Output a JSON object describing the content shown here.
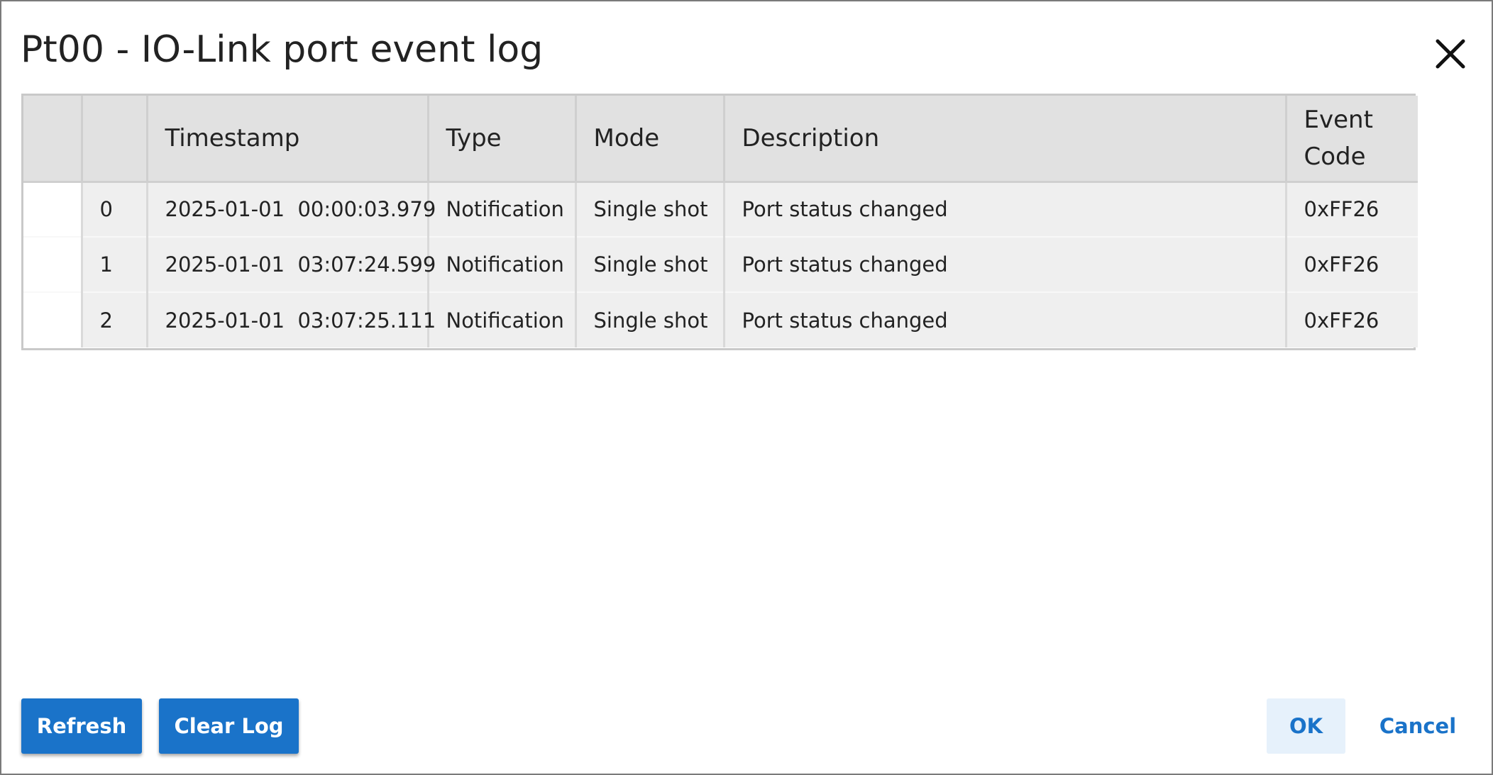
{
  "dialog": {
    "title": "Pt00 - IO-Link port event log",
    "close_icon": "close-icon"
  },
  "table": {
    "columns": [
      "",
      "",
      "Timestamp",
      "Type",
      "Mode",
      "Description",
      "Event Code"
    ],
    "rows": [
      {
        "index": "0",
        "timestamp": "2025-01-01  00:00:03.979",
        "type": "Notification",
        "mode": "Single shot",
        "description": "Port status changed",
        "event_code": "0xFF26"
      },
      {
        "index": "1",
        "timestamp": "2025-01-01  03:07:24.599",
        "type": "Notification",
        "mode": "Single shot",
        "description": "Port status changed",
        "event_code": "0xFF26"
      },
      {
        "index": "2",
        "timestamp": "2025-01-01  03:07:25.111",
        "type": "Notification",
        "mode": "Single shot",
        "description": "Port status changed",
        "event_code": "0xFF26"
      }
    ]
  },
  "footer": {
    "refresh_label": "Refresh",
    "clear_log_label": "Clear Log",
    "ok_label": "OK",
    "cancel_label": "Cancel"
  },
  "colors": {
    "primary": "#1a73c9",
    "header_bg": "#e1e1e1",
    "row_bg": "#efefef"
  }
}
